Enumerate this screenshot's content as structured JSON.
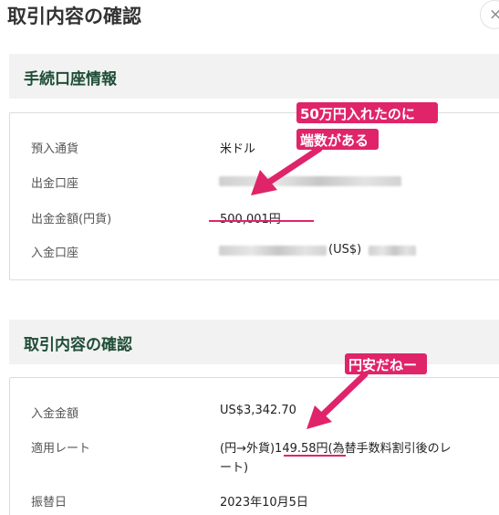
{
  "title": "取引内容の確認",
  "close_symbol": "×",
  "account_section": {
    "heading": "手続口座情報",
    "rows": [
      {
        "label": "預入通貨",
        "value": "米ドル"
      },
      {
        "label": "出金口座",
        "value": ""
      },
      {
        "label": "出金金額(円貨)",
        "value": "500,001円"
      },
      {
        "label": "入金口座",
        "value": "(US$)"
      }
    ]
  },
  "transaction_section": {
    "heading": "取引内容の確認",
    "rows": [
      {
        "label": "入金金額",
        "value": "US$3,342.70"
      },
      {
        "label": "適用レート",
        "value_prefix": "(円→外貨)",
        "rate": "149.58円",
        "value_suffix": "(為替手数料割引後のレ",
        "value_line2": "ート)"
      },
      {
        "label": "振替日",
        "value": "2023年10月5日"
      }
    ]
  },
  "annotations": {
    "note1_line1": "50万円入れたのに",
    "note1_line2": "端数がある",
    "note2": "円安だねー",
    "accent": "#e0246a"
  },
  "colors": {
    "heading_text": "#1f4d36",
    "section_bg": "#f1f2f1"
  }
}
